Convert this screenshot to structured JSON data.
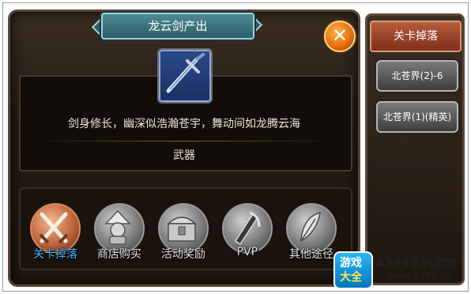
{
  "dialog": {
    "title": "龙云剑产出",
    "close_symbol": "✕",
    "item_description": "剑身修长，幽深似浩瀚苍宇，舞动间如龙腾云海",
    "item_type": "武器"
  },
  "sources": [
    {
      "label": "关卡掉落",
      "icon": "crossed-swords-icon",
      "active": true
    },
    {
      "label": "商店购买",
      "icon": "merchant-icon",
      "active": false
    },
    {
      "label": "活动奖励",
      "icon": "treasure-chest-icon",
      "active": false
    },
    {
      "label": "PVP",
      "icon": "pvp-sword-icon",
      "active": false
    },
    {
      "label": "其他途径",
      "icon": "feather-icon",
      "active": false
    }
  ],
  "side_panel": {
    "header": "关卡掉落",
    "stages": [
      "北苍界(2)-6",
      "北苍界(1)(精英)"
    ]
  },
  "watermark": {
    "badge_top": "游戏",
    "badge_bottom": "大全",
    "name": "4399手机游戏",
    "url": "www.4399.cn"
  },
  "colors": {
    "panel_bg": "#241b14",
    "banner": "#2c5c66",
    "close_button": "#e36a0c",
    "active_label": "#47b6ff",
    "side_header": "#7e2f1d"
  }
}
